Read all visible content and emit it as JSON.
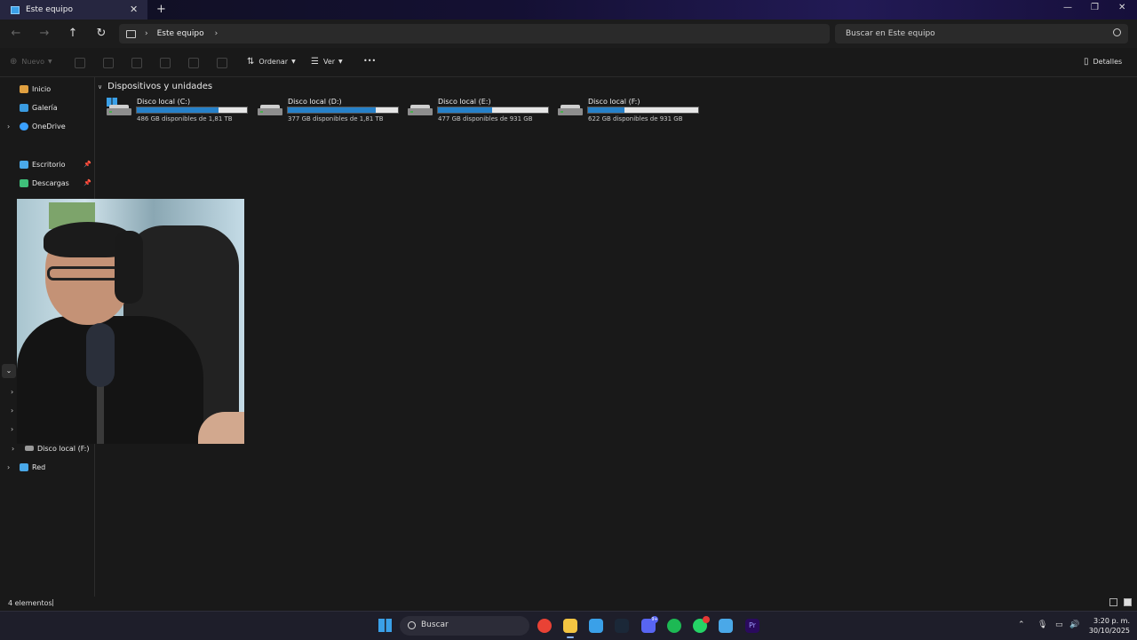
{
  "window": {
    "tab_title": "Este equipo",
    "close_tab": "✕",
    "new_tab": "+",
    "minimize": "—",
    "maximize": "❐",
    "close": "✕"
  },
  "navigation": {
    "back": "←",
    "forward": "→",
    "up": "↑",
    "refresh": "↻",
    "breadcrumb": [
      "Este equipo"
    ],
    "search_placeholder": "Buscar en Este equipo"
  },
  "commands": {
    "new_label": "Nuevo",
    "sort_label": "Ordenar",
    "view_label": "Ver",
    "more": "•••",
    "details_label": "Detalles"
  },
  "sidebar": {
    "items": [
      {
        "label": "Inicio",
        "icon": "home-icon",
        "color": "#e0a040"
      },
      {
        "label": "Galería",
        "icon": "gallery-icon",
        "color": "#3a9be0"
      },
      {
        "label": "OneDrive",
        "icon": "cloud-icon",
        "color": "#3aa0ff"
      },
      {
        "label": "Escritorio",
        "icon": "desktop-icon",
        "color": "#4aa8e8"
      },
      {
        "label": "Descargas",
        "icon": "download-icon",
        "color": "#3fbf7a"
      },
      {
        "label": "Disco local (F:)",
        "icon": "drive-icon",
        "color": "#9a9a9a"
      },
      {
        "label": "Red",
        "icon": "network-icon",
        "color": "#4aa8e8"
      }
    ]
  },
  "main": {
    "section_title": "Dispositivos y unidades",
    "drives": [
      {
        "name": "Disco local (C:)",
        "free": "486 GB disponibles de 1,81 TB",
        "used_fraction": 0.74
      },
      {
        "name": "Disco local (D:)",
        "free": "377 GB disponibles de 1,81 TB",
        "used_fraction": 0.8
      },
      {
        "name": "Disco local (E:)",
        "free": "477 GB disponibles de 931 GB",
        "used_fraction": 0.49
      },
      {
        "name": "Disco local (F:)",
        "free": "622 GB disponibles de 931 GB",
        "used_fraction": 0.33
      }
    ]
  },
  "status": {
    "count": "4 elementos",
    "separator": "|"
  },
  "taskbar": {
    "search_label": "Buscar",
    "apps": [
      {
        "name": "chrome",
        "color": "#e94235"
      },
      {
        "name": "file-explorer",
        "color": "#f4c542"
      },
      {
        "name": "store",
        "color": "#3aa0e8"
      },
      {
        "name": "steam",
        "color": "#1b2838"
      },
      {
        "name": "discord",
        "color": "#5865f2"
      },
      {
        "name": "spotify",
        "color": "#1db954"
      },
      {
        "name": "whatsapp",
        "color": "#25d366"
      },
      {
        "name": "remote-desktop",
        "color": "#4aa8e8"
      },
      {
        "name": "premiere-pro",
        "color": "#2a0a5e"
      }
    ],
    "discord_badge": "9+",
    "time": "3:20 p. m.",
    "date": "30/10/2025"
  }
}
